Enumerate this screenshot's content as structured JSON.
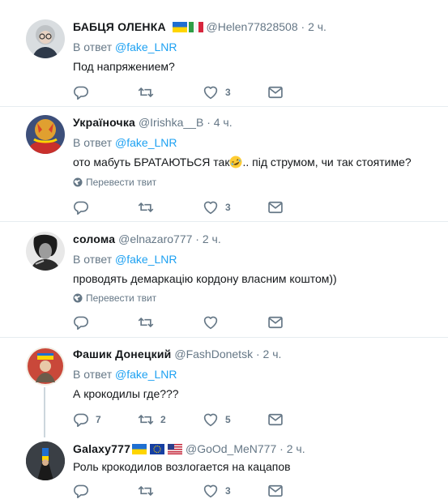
{
  "common": {
    "reply_prefix": "В ответ",
    "dot": "·",
    "translate_label": "Перевести твит"
  },
  "tweets": [
    {
      "name": "БАБЦЯ ОЛЕНКА",
      "handle": "@Helen77828508",
      "time": "2 ч.",
      "reply_to": "@fake_LNR",
      "text": "Под напряжением?",
      "reply_count": "",
      "retweet_count": "",
      "like_count": "3"
    },
    {
      "name": "Україночка",
      "handle": "@Irishka__B",
      "time": "4 ч.",
      "text_before": "ото мабуть БРАТАЮТЬСЯ так",
      "text_after": ".. під струмом, чи так стоятиме?",
      "reply_count": "",
      "retweet_count": "",
      "like_count": "3"
    },
    {
      "name": "солома",
      "handle": "@elnazaro777",
      "time": "2 ч.",
      "reply_to": "@fake_LNR",
      "text": "проводять демаркацію кордону власним коштом))",
      "reply_count": "",
      "retweet_count": "",
      "like_count": ""
    },
    {
      "name": "Фашик Донецкий",
      "handle": "@FashDonetsk",
      "time": "2 ч.",
      "reply_to": "@fake_LNR",
      "text": "А крокодилы где???",
      "reply_count": "7",
      "retweet_count": "2",
      "like_count": "5"
    },
    {
      "name": "Galaxy777",
      "handle": "@GoOd_MeN777",
      "time": "2 ч.",
      "text": "Роль крокодилов возлогается на кацапов",
      "reply_count": "",
      "retweet_count": "",
      "like_count": "3"
    }
  ],
  "colors": {
    "accent": "#1da1f2",
    "muted": "#657786",
    "divider": "#e6ecf0"
  }
}
